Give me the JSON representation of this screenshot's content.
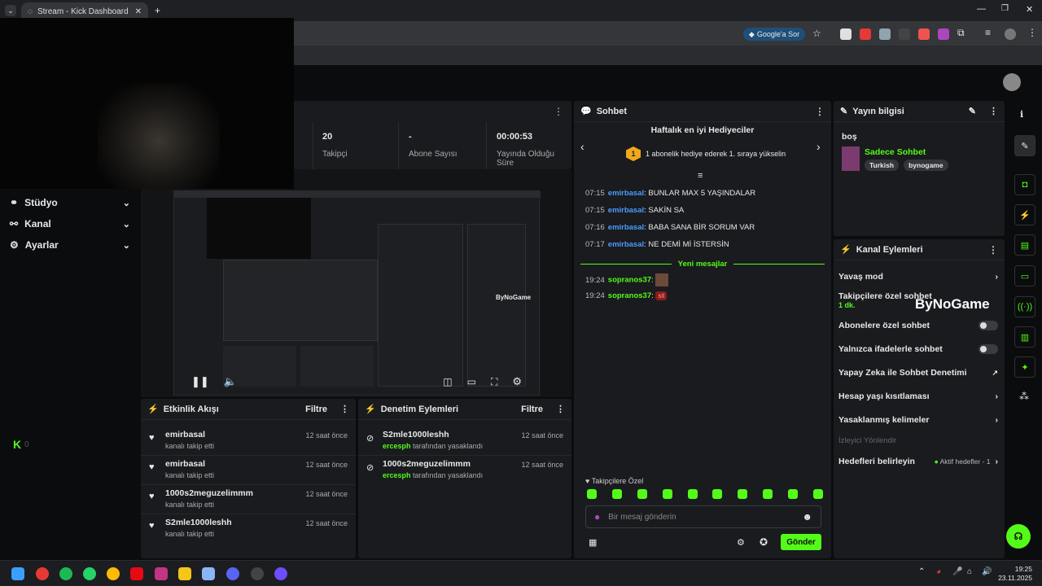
{
  "browser": {
    "tab_title": "Stream - Kick Dashboard",
    "google_button": "Google'a Sor"
  },
  "sidebar": {
    "items": [
      {
        "label": "Stüdyo"
      },
      {
        "label": "Kanal"
      },
      {
        "label": "Ayarlar"
      }
    ],
    "logo_count": "0"
  },
  "stats": [
    {
      "value": "",
      "label": ""
    },
    {
      "value": "20",
      "label": "Takipçi"
    },
    {
      "value": "-",
      "label": "Abone Sayısı"
    },
    {
      "value": "00:00:53",
      "label": "Yayında Olduğu Süre"
    }
  ],
  "activity": {
    "title": "Etkinlik Akışı",
    "filter": "Filtre",
    "items": [
      {
        "name": "emirbasal",
        "sub": "kanalı takip etti",
        "time": "12 saat önce"
      },
      {
        "name": "emirbasal",
        "sub": "kanalı takip etti",
        "time": "12 saat önce"
      },
      {
        "name": "1000s2meguzelimmm",
        "sub": "kanalı takip etti",
        "time": "12 saat önce"
      },
      {
        "name": "S2mle1000leshh",
        "sub": "kanalı takip etti",
        "time": "12 saat önce"
      }
    ]
  },
  "moderation": {
    "title": "Denetim Eylemleri",
    "filter": "Filtre",
    "items": [
      {
        "name": "S2mle1000leshh",
        "by": "ercesph",
        "sub": "tarafından yasaklandı",
        "time": "12 saat önce"
      },
      {
        "name": "1000s2meguzelimmm",
        "by": "ercesph",
        "sub": "tarafından yasaklandı",
        "time": "12 saat önce"
      }
    ]
  },
  "chat": {
    "title": "Sohbet",
    "gifters_title": "Haftalık en iyi Hediyeciler",
    "gifter_rank": "1",
    "gifter_text": "1 abonelik hediye ederek 1. sıraya yükselin",
    "messages": [
      {
        "time": "07:15",
        "user": "emirbasal",
        "text": ": BUNLAR MAX 5 YAŞINDALAR"
      },
      {
        "time": "07:15",
        "user": "emirbasal",
        "text": ": SAKİN SA"
      },
      {
        "time": "07:16",
        "user": "emirbasal",
        "text": ": BABA SANA BİR SORUM VAR"
      },
      {
        "time": "07:17",
        "user": "emirbasal",
        "text": ": NE DEMİ Mİ İSTERSİN"
      }
    ],
    "new_messages": "Yeni mesajlar",
    "new": [
      {
        "time": "19:24",
        "user": "sopranos37",
        "text": ":"
      },
      {
        "time": "19:24",
        "user": "sopranos37",
        "text": ":",
        "emote": "sit"
      }
    ],
    "followers_only": "Takipçilere Özel",
    "input_placeholder": "Bir mesaj gönderin",
    "send": "Gönder"
  },
  "stream_info": {
    "title": "Yayın bilgisi",
    "stream_title": "boş",
    "category": "Sadece Sohbet",
    "tags": [
      "Turkish",
      "bynogame"
    ]
  },
  "channel_actions": {
    "title": "Kanal Eylemleri",
    "items": [
      {
        "label": "Yavaş mod"
      },
      {
        "label": "Takipçilere özel sohbet",
        "sub": "1 dk."
      },
      {
        "label": "Abonelere özel sohbet"
      },
      {
        "label": "Yalnızca ifadelerle sohbet"
      },
      {
        "label": "Yapay Zeka ile Sohbet Denetimi"
      },
      {
        "label": "Hesap yaşı kısıtlaması"
      },
      {
        "label": "Yasaklanmış kelimeler"
      },
      {
        "label": "İzleyici Yönlendir"
      },
      {
        "label": "Hedefleri belirleyin",
        "status": "Aktif hedefler - 1"
      }
    ],
    "watermark": "ByNoGame"
  },
  "taskbar": {
    "time": "19:25",
    "date": "23.11.2025"
  },
  "colors": {
    "accent": "#53fc18",
    "username": "#4a9cff",
    "panel": "#1a1b1e"
  }
}
